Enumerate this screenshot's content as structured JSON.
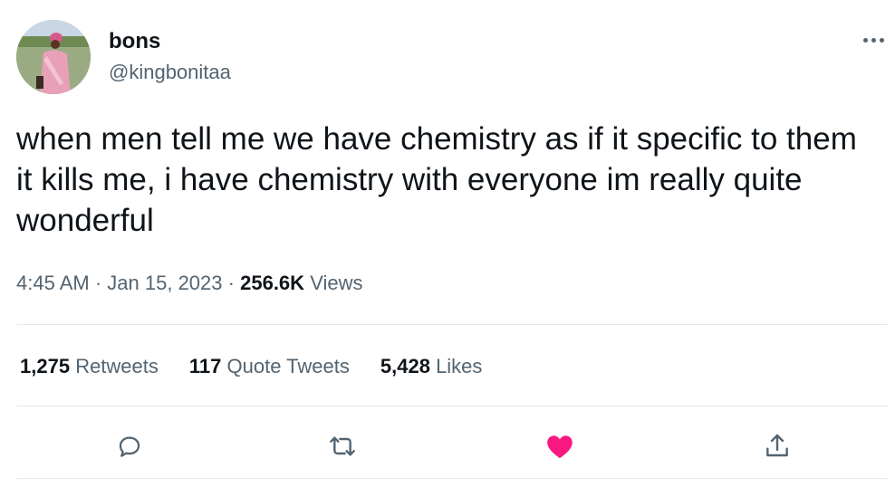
{
  "author": {
    "display_name": "bons",
    "handle": "@kingbonitaa"
  },
  "tweet": {
    "text": "when men tell me we have chemistry as if it specific to them it kills me, i have chemistry with everyone im really quite wonderful",
    "time": "4:45 AM",
    "separator": "·",
    "date": "Jan 15, 2023",
    "views_count": "256.6K",
    "views_label": "Views"
  },
  "stats": {
    "retweets_count": "1,275",
    "retweets_label": "Retweets",
    "quotes_count": "117",
    "quotes_label": "Quote Tweets",
    "likes_count": "5,428",
    "likes_label": "Likes"
  },
  "actions": [
    {
      "icon": "reply-icon"
    },
    {
      "icon": "retweet-icon"
    },
    {
      "icon": "like-icon",
      "liked": true
    },
    {
      "icon": "share-icon"
    }
  ],
  "colors": {
    "text_primary": "#0f1419",
    "text_secondary": "#536471",
    "divider": "#e6e8ea",
    "like_active": "#f91880"
  }
}
